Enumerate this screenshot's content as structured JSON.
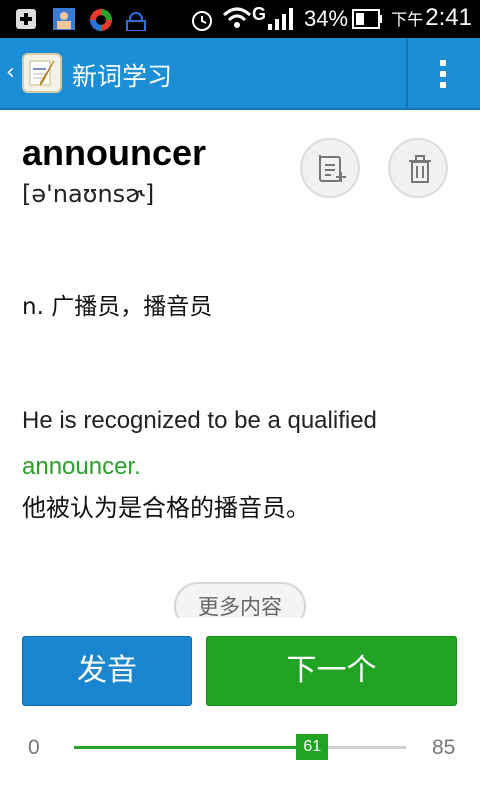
{
  "status_bar": {
    "battery_percent": "34%",
    "time_prefix": "下午",
    "time": "2:41",
    "network_label": "G"
  },
  "action_bar": {
    "title": "新词学习"
  },
  "word": {
    "text": "announcer",
    "phonetic": "[ə'naʊnsɚ]",
    "meaning": "n. 广播员，播音员"
  },
  "example": {
    "before": "He is recognized to be a qualified ",
    "highlight": "announcer.",
    "translation": "他被认为是合格的播音员。"
  },
  "more_button": {
    "label": "更多内容"
  },
  "buttons": {
    "speak": "发音",
    "next": "下一个"
  },
  "progress": {
    "min": "0",
    "max": "85",
    "value": 61,
    "value_label": "61",
    "min_value": 0,
    "max_value": 85
  },
  "colors": {
    "action_bar": "#1b8ed6",
    "primary_blue": "#1a86d0",
    "accent_green": "#21a324"
  }
}
